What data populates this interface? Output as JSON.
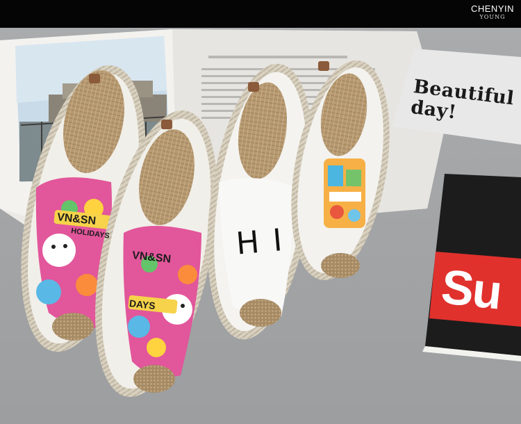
{
  "brand": {
    "name": "CHENYIN",
    "sub": "YOUNG"
  },
  "card": {
    "line1": "Beautiful",
    "line2": "day!"
  },
  "book": {
    "text": "Su"
  },
  "shoe_prints": {
    "left_big": "VN&SN",
    "left_sub": "HOLIDAYS",
    "front_big": "VN&SN",
    "front_sub": "DAYS",
    "white": "HI"
  },
  "colors": {
    "background": "#a5a7a9",
    "topbar": "#050505",
    "book_red": "#e0312c",
    "book_black": "#1c1c1c"
  }
}
